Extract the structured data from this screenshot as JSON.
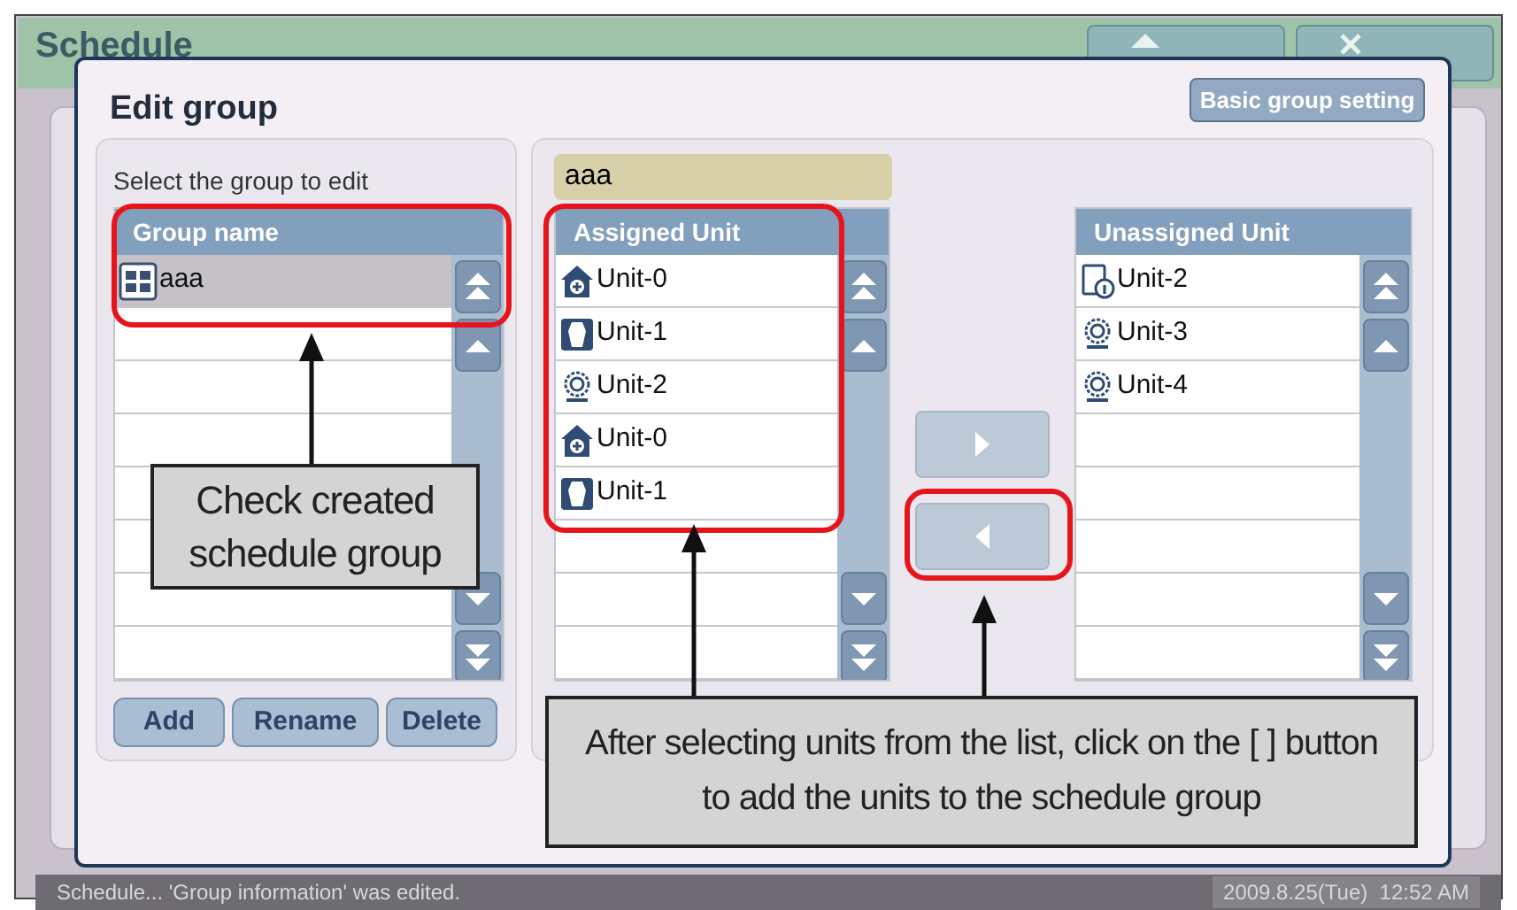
{
  "background": {
    "title": "Schedule",
    "buttons": [
      {
        "kind": "home"
      },
      {
        "kind": "logout"
      }
    ]
  },
  "dialog": {
    "title": "Edit group",
    "header_button": "Basic group setting",
    "group_panel": {
      "label": "Select the group to edit",
      "column": "Group name",
      "items": [
        {
          "name": "aaa",
          "selected": true
        }
      ],
      "buttons": [
        "Add",
        "Rename",
        "Delete"
      ]
    },
    "group_name_field": {
      "value": "aaa"
    },
    "assigned": {
      "column": "Assigned Unit",
      "units": [
        {
          "name": "Unit-0",
          "kind": "house"
        },
        {
          "name": "Unit-1",
          "kind": "vent"
        },
        {
          "name": "Unit-2",
          "kind": "awhp"
        },
        {
          "name": "Unit-0",
          "kind": "house"
        },
        {
          "name": "Unit-1",
          "kind": "vent"
        }
      ]
    },
    "move_buttons": [
      {
        "kind": "right"
      },
      {
        "kind": "left"
      }
    ],
    "unassigned": {
      "column": "Unassigned Unit",
      "units": [
        {
          "name": "Unit-2",
          "kind": "info"
        },
        {
          "name": "Unit-3",
          "kind": "awhp"
        },
        {
          "name": "Unit-4",
          "kind": "awhp"
        }
      ]
    }
  },
  "annotations": [
    {
      "text": "Check created schedule group"
    },
    {
      "text": "After selecting units from the list, click on the [ ] button to add the units to the schedule group"
    }
  ],
  "status_bar": {
    "message": "Schedule... 'Group information' was edited.",
    "datetime": "2009.8.25(Tue)  12:52 AM"
  }
}
